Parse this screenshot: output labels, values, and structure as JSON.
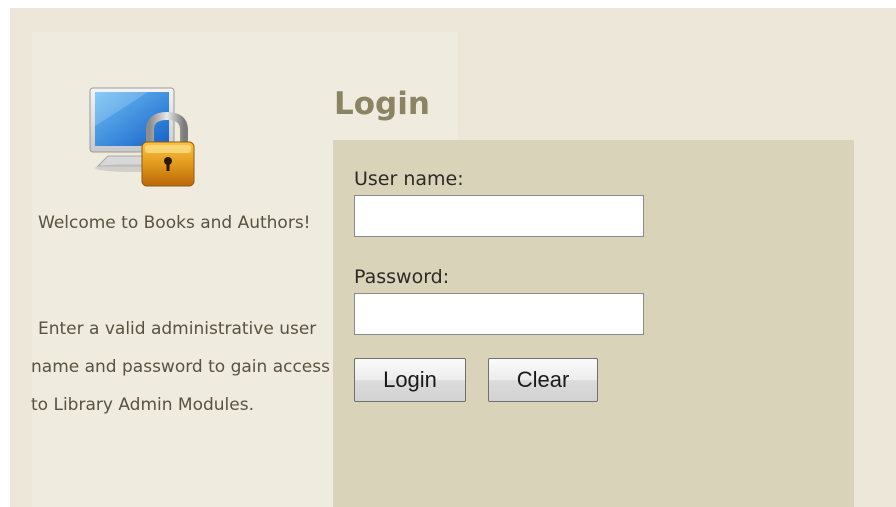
{
  "sidebar": {
    "welcome_text": "Welcome to Books and Authors!",
    "instructions_text": "Enter a valid administrative user name and password to gain access to  Library Admin Modules.",
    "icon": "computer-lock-icon"
  },
  "login": {
    "title": "Login",
    "username_label": "User name:",
    "username_value": "",
    "password_label": "Password:",
    "password_value": "",
    "login_button": "Login",
    "clear_button": "Clear"
  },
  "colors": {
    "page_background": "#ece7d8",
    "form_background": "#d9d3b9",
    "title_color": "#8a8463"
  }
}
